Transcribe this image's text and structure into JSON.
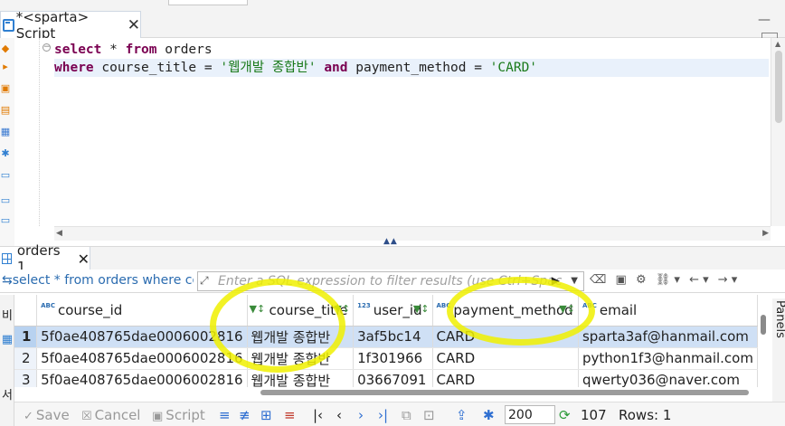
{
  "editor_tab": {
    "title": "*<sparta> Script",
    "close": "✕"
  },
  "editor": {
    "line1": {
      "kw1": "select",
      "t1": " * ",
      "kw2": "from",
      "t2": " orders"
    },
    "line2": {
      "kw1": "where",
      "t1": " course_title = ",
      "s1": "'웹개발 종합반'",
      "t2": " ",
      "kw2": "and",
      "t3": " payment_method = ",
      "s2": "'CARD'"
    }
  },
  "results_tab": {
    "label": "orders 1",
    "close": "✕"
  },
  "filter": {
    "query_text": "select * from orders where co",
    "placeholder": "Enter a SQL expression to filter results (use Ctrl+Space)"
  },
  "grid": {
    "columns": [
      {
        "name": "course_id",
        "type": "ABC"
      },
      {
        "name": "course_title",
        "type": "ABC"
      },
      {
        "name": "user_id",
        "type": "123"
      },
      {
        "name": "payment_method",
        "type": "ABC"
      },
      {
        "name": "email",
        "type": "ABC"
      }
    ],
    "rows": [
      {
        "num": "1",
        "cells": [
          "5f0ae408765dae0006002816",
          "웹개발 종합반",
          "3af5bc14",
          "CARD",
          "sparta3af@hanmail.com"
        ]
      },
      {
        "num": "2",
        "cells": [
          "5f0ae408765dae0006002816",
          "웹개발 종합반",
          "1f301966",
          "CARD",
          "python1f3@hanmail.com"
        ]
      },
      {
        "num": "3",
        "cells": [
          "5f0ae408765dae0006002816",
          "웹개발 종합반",
          "03667091",
          "CARD",
          "qwerty036@naver.com"
        ]
      }
    ],
    "selected_row": 1
  },
  "side_tabs": {
    "left_top": "비",
    "left_bottom": "서",
    "right": "Panels"
  },
  "bottom_toolbar": {
    "save": "Save",
    "cancel": "Cancel",
    "script": "Script",
    "fetch_size": "200",
    "rows_fetched": "107",
    "rows_label": "Rows: 1"
  },
  "colors": {
    "highlighter": "#f0f000",
    "keyword": "#7a0051",
    "string": "#1a7a1a",
    "selected_row": "#cfe0f5",
    "accent": "#2f7fd1"
  },
  "icons": [
    "editor-script-icon",
    "close-icon",
    "grid-icon",
    "filter-expand-icon",
    "apply-filter-icon",
    "sort-filter-icon",
    "nav-first-icon",
    "nav-prev-icon",
    "nav-next-icon",
    "nav-last-icon",
    "refresh-icon",
    "settings-icon"
  ]
}
